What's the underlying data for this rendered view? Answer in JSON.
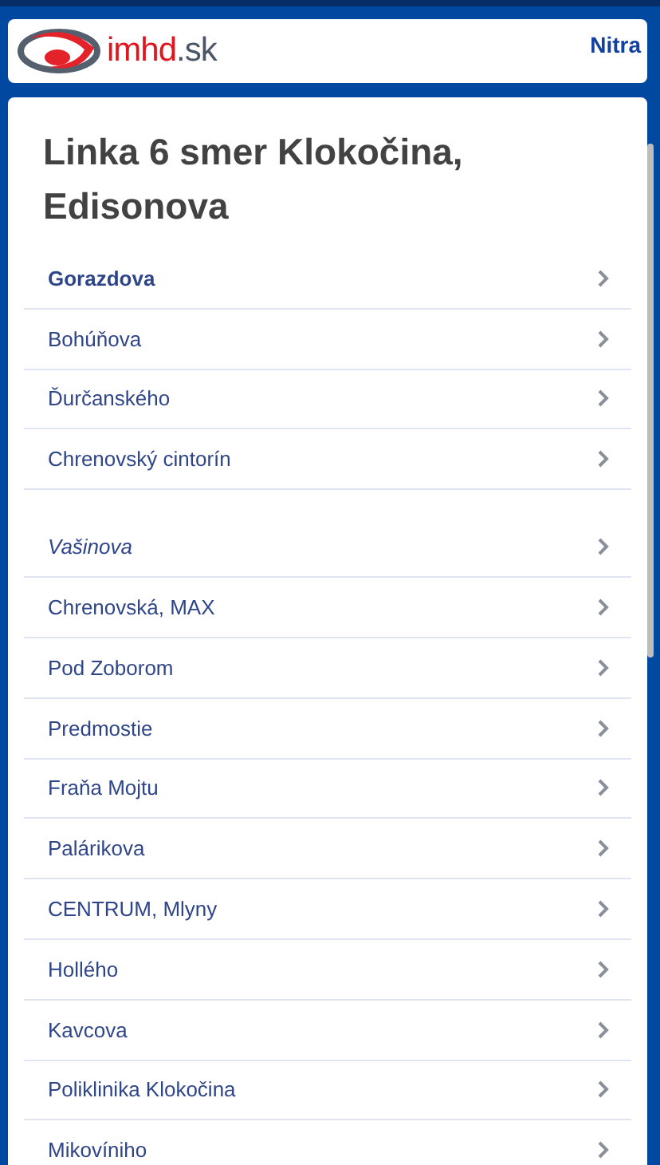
{
  "header": {
    "logo": {
      "name": "imhd",
      "domain": ".sk"
    },
    "city": "Nitra"
  },
  "title": "Linka 6 smer Klokočina, Edisonova",
  "stops": [
    {
      "name": "Gorazdova",
      "kind": "current"
    },
    {
      "name": "Bohúňova",
      "kind": "normal"
    },
    {
      "name": "Ďurčanského",
      "kind": "normal"
    },
    {
      "name": "Chrenovský cintorín",
      "kind": "normal"
    },
    {
      "name": "Vašinova",
      "kind": "request"
    },
    {
      "name": "Chrenovská, MAX",
      "kind": "normal"
    },
    {
      "name": "Pod Zoborom",
      "kind": "normal"
    },
    {
      "name": "Predmostie",
      "kind": "normal"
    },
    {
      "name": "Fraňa Mojtu",
      "kind": "normal"
    },
    {
      "name": "Palárikova",
      "kind": "normal"
    },
    {
      "name": "CENTRUM, Mlyny",
      "kind": "normal"
    },
    {
      "name": "Hollého",
      "kind": "normal"
    },
    {
      "name": "Kavcova",
      "kind": "normal"
    },
    {
      "name": "Poliklinika Klokočina",
      "kind": "normal"
    },
    {
      "name": "Mikovíniho",
      "kind": "normal"
    }
  ]
}
